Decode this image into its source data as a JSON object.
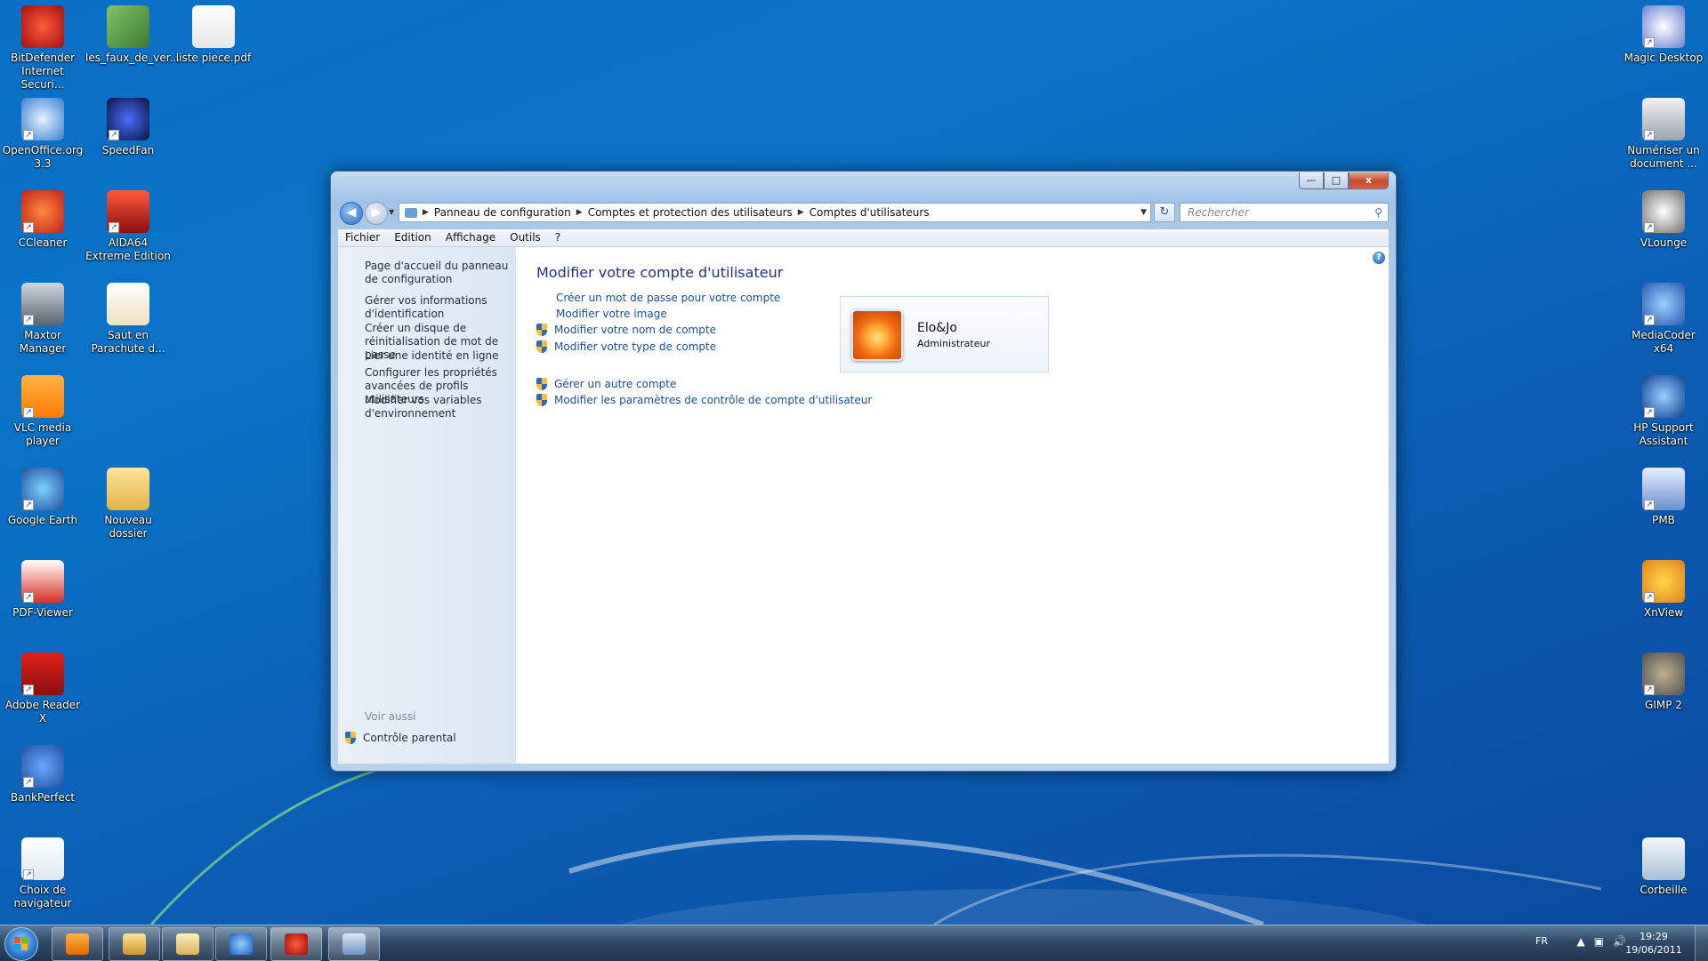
{
  "desktop": {
    "icons_left": [
      {
        "label": "BitDefender Internet Securi...",
        "icon": "bitdefender-icon"
      },
      {
        "label": "les_faux_de_ver...",
        "icon": "image-file-icon"
      },
      {
        "label": "liste piece.pdf",
        "icon": "pdf-document-icon"
      },
      {
        "label": "OpenOffice.org 3.3",
        "icon": "openoffice-icon"
      },
      {
        "label": "SpeedFan",
        "icon": "speedfan-icon"
      },
      {
        "label": "CCleaner",
        "icon": "ccleaner-icon"
      },
      {
        "label": "AIDA64 Extreme Edition",
        "icon": "aida64-icon"
      },
      {
        "label": "Maxtor Manager",
        "icon": "maxtor-icon"
      },
      {
        "label": "Saut en Parachute d...",
        "icon": "document-icon"
      },
      {
        "label": "VLC media player",
        "icon": "vlc-icon"
      },
      {
        "label": "Google Earth",
        "icon": "google-earth-icon"
      },
      {
        "label": "Nouveau dossier",
        "icon": "folder-icon"
      },
      {
        "label": "PDF-Viewer",
        "icon": "pdf-viewer-icon"
      },
      {
        "label": "Adobe Reader X",
        "icon": "adobe-reader-icon"
      },
      {
        "label": "BankPerfect",
        "icon": "bankperfect-icon"
      },
      {
        "label": "Choix de navigateur",
        "icon": "browser-choice-icon"
      }
    ],
    "icons_right": [
      {
        "label": "Magic Desktop",
        "icon": "magic-desktop-icon"
      },
      {
        "label": "Numériser un document ...",
        "icon": "scanner-icon"
      },
      {
        "label": "VLounge",
        "icon": "vlounge-icon"
      },
      {
        "label": "MediaCoder x64",
        "icon": "mediacoder-icon"
      },
      {
        "label": "HP Support Assistant",
        "icon": "hp-support-icon"
      },
      {
        "label": "PMB",
        "icon": "pmb-icon"
      },
      {
        "label": "XnView",
        "icon": "xnview-icon"
      },
      {
        "label": "GIMP 2",
        "icon": "gimp-icon"
      },
      {
        "label": "Corbeille",
        "icon": "recycle-bin-icon"
      }
    ]
  },
  "window": {
    "breadcrumbs": [
      "Panneau de configuration",
      "Comptes et protection des utilisateurs",
      "Comptes d'utilisateurs"
    ],
    "search_placeholder": "Rechercher",
    "controls": {
      "minimize": "—",
      "maximize": "□",
      "close": "x"
    },
    "menu": [
      "Fichier",
      "Edition",
      "Affichage",
      "Outils",
      "?"
    ],
    "sidebar": {
      "links": [
        "Page d'accueil du panneau de configuration",
        "Gérer vos informations d'identification",
        "Créer un disque de réinitialisation de mot de passe",
        "Lier une identité en ligne",
        "Configurer les propriétés avancées de profils utilisateurs",
        "Modifier vos variables d'environnement"
      ],
      "see_also": "Voir aussi",
      "parental": "Contrôle parental"
    },
    "main": {
      "title": "Modifier votre compte d'utilisateur",
      "links": [
        {
          "label": "Créer un mot de passe pour votre compte",
          "shield": false
        },
        {
          "label": "Modifier votre image",
          "shield": false
        },
        {
          "label": "Modifier votre nom de compte",
          "shield": true
        },
        {
          "label": "Modifier votre type de compte",
          "shield": true
        }
      ],
      "links2": [
        {
          "label": "Gérer un autre compte",
          "shield": true
        },
        {
          "label": "Modifier les paramètres de contrôle de compte d'utilisateur",
          "shield": true
        }
      ],
      "account": {
        "name": "Elo&Jo",
        "role": "Administrateur"
      },
      "help": "?"
    }
  },
  "taskbar": {
    "buttons": [
      {
        "icon": "media-player-icon"
      },
      {
        "icon": "explorer-icon"
      },
      {
        "icon": "folder-icon"
      },
      {
        "icon": "internet-explorer-icon"
      },
      {
        "icon": "bitdefender-icon"
      },
      {
        "icon": "control-panel-icon"
      }
    ],
    "language": "FR",
    "time": "19:29",
    "date": "19/06/2011"
  }
}
